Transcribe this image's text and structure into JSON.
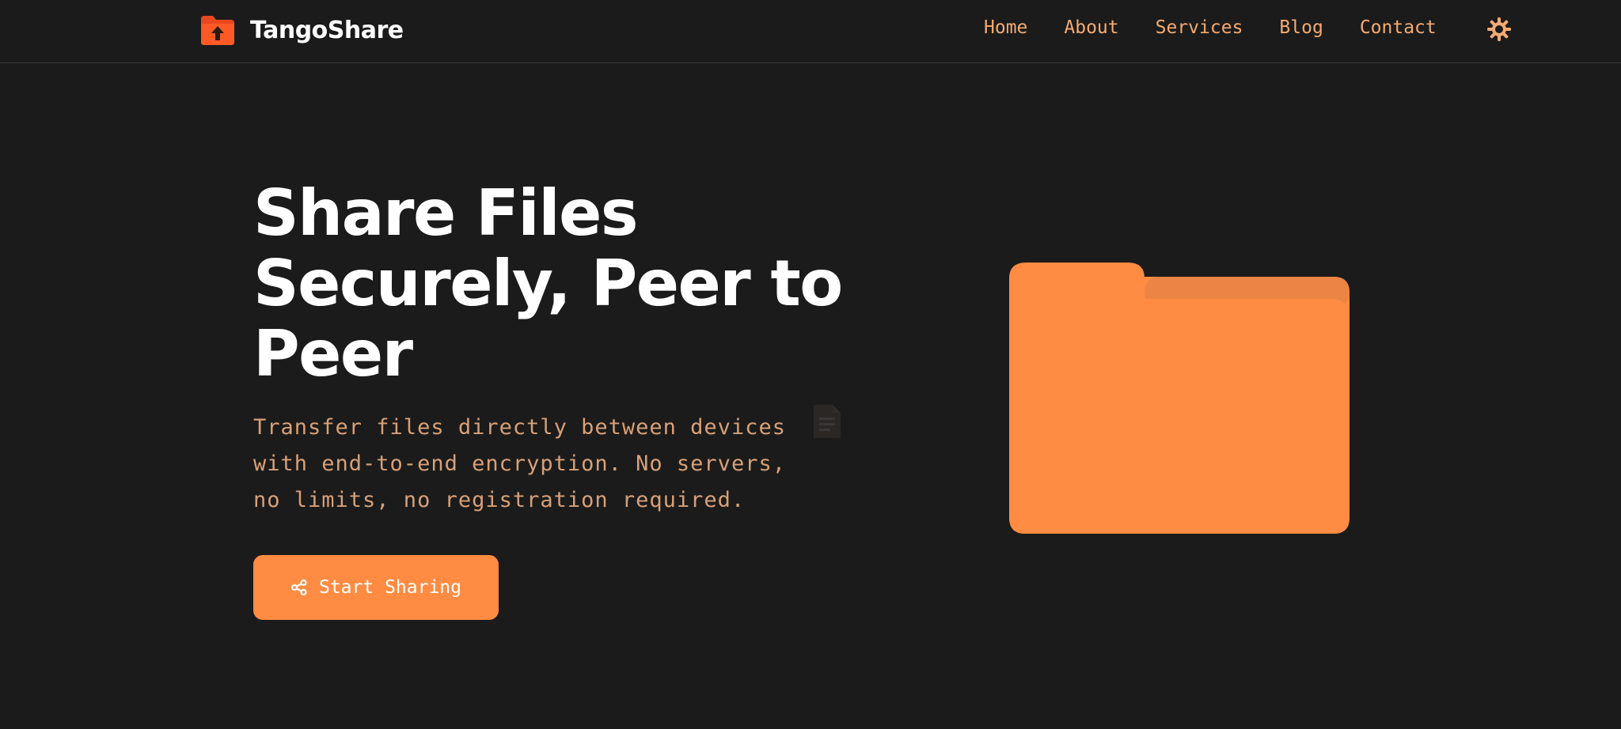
{
  "header": {
    "brand": "TangoShare",
    "logo_icon": "folder-upload-icon",
    "nav": [
      {
        "label": "Home"
      },
      {
        "label": "About"
      },
      {
        "label": "Services"
      },
      {
        "label": "Blog"
      },
      {
        "label": "Contact"
      }
    ],
    "theme_toggle_icon": "sun-icon"
  },
  "hero": {
    "title": "Share Files Securely, Peer to Peer",
    "subtitle": "Transfer files directly between devices with end-to-end encryption. No servers, no limits, no registration required.",
    "cta_label": "Start Sharing",
    "cta_icon": "share-icon",
    "illustration_icon": "folder-icon"
  },
  "colors": {
    "background": "#1b1b1b",
    "accent": "#ff8c42",
    "nav_text": "#f5ab73",
    "subtitle_text": "#d9a077",
    "logo_red": "#e8471f",
    "heading": "#ffffff"
  }
}
